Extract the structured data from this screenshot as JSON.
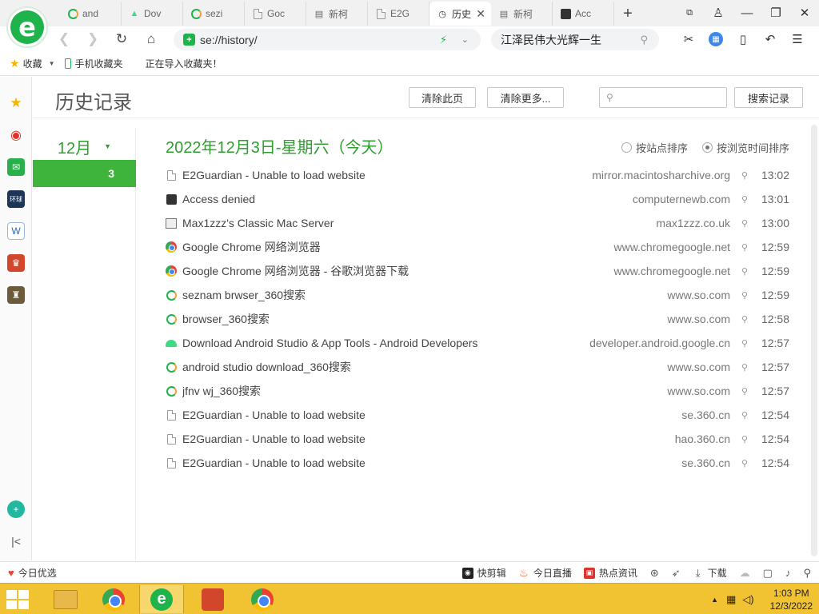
{
  "tabs": [
    {
      "label": "and",
      "icon": "so360-icon"
    },
    {
      "label": "Dov",
      "icon": "android-icon"
    },
    {
      "label": "sezi",
      "icon": "so360-icon"
    },
    {
      "label": "Goc",
      "icon": "document-icon"
    },
    {
      "label": "新柯",
      "icon": "newtab-icon"
    },
    {
      "label": "E2G",
      "icon": "document-icon"
    },
    {
      "label": "历史",
      "icon": "history-icon",
      "active": true
    },
    {
      "label": "新柯",
      "icon": "newtab-icon"
    },
    {
      "label": "Acc",
      "icon": "lock-icon"
    }
  ],
  "address": {
    "url": "se://history/",
    "search_text": "江泽民伟大光辉一生"
  },
  "bookmarks": {
    "favorites": "收藏",
    "mobile": "手机收藏夹",
    "importing": "正在导入收藏夹！"
  },
  "page": {
    "title": "历史记录",
    "clear_page": "清除此页",
    "clear_more": "清除更多...",
    "search_button": "搜索记录",
    "month": "12月",
    "day": "3",
    "day_title": "2022年12月3日-星期六（今天）",
    "sort_by_site": "按站点排序",
    "sort_by_time": "按浏览时间排序"
  },
  "history": [
    {
      "title": "E2Guardian - Unable to load website",
      "domain": "mirror.macintosharchive.org",
      "time": "13:02",
      "icon": "document"
    },
    {
      "title": "Access denied",
      "domain": "computernewb.com",
      "time": "13:01",
      "icon": "lock"
    },
    {
      "title": "Max1zzz's Classic Mac Server",
      "domain": "max1zzz.co.uk",
      "time": "13:00",
      "icon": "mac"
    },
    {
      "title": "Google Chrome 网络浏览器",
      "domain": "www.chromegoogle.net",
      "time": "12:59",
      "icon": "chrome"
    },
    {
      "title": "Google Chrome 网络浏览器 - 谷歌浏览器下载",
      "domain": "www.chromegoogle.net",
      "time": "12:59",
      "icon": "chrome"
    },
    {
      "title": "seznam brwser_360搜索",
      "domain": "www.so.com",
      "time": "12:59",
      "icon": "so360"
    },
    {
      "title": "browser_360搜索",
      "domain": "www.so.com",
      "time": "12:58",
      "icon": "so360"
    },
    {
      "title": "Download Android Studio & App Tools - Android Developers",
      "domain": "developer.android.google.cn",
      "time": "12:57",
      "icon": "android"
    },
    {
      "title": "android studio download_360搜索",
      "domain": "www.so.com",
      "time": "12:57",
      "icon": "so360"
    },
    {
      "title": "jfnv wj_360搜索",
      "domain": "www.so.com",
      "time": "12:57",
      "icon": "so360"
    },
    {
      "title": "E2Guardian - Unable to load website",
      "domain": "se.360.cn",
      "time": "12:54",
      "icon": "document"
    },
    {
      "title": "E2Guardian - Unable to load website",
      "domain": "hao.360.cn",
      "time": "12:54",
      "icon": "document"
    },
    {
      "title": "E2Guardian - Unable to load website",
      "domain": "se.360.cn",
      "time": "12:54",
      "icon": "document"
    }
  ],
  "statusbar": {
    "today_pick": "今日优选",
    "quick_cut": "快剪辑",
    "live_today": "今日直播",
    "hot_news": "热点资讯",
    "download": "下载"
  },
  "taskbar": {
    "time": "1:03 PM",
    "date": "12/3/2022"
  },
  "colors": {
    "accent_green": "#3fb43c",
    "title_green": "#2e9e2e",
    "taskbar": "#f1c232"
  }
}
